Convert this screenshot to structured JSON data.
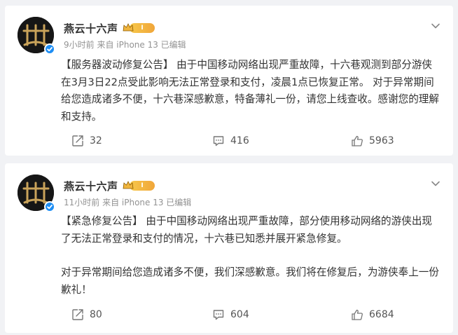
{
  "posts": [
    {
      "author": "燕云十六声",
      "level_badge": "I",
      "meta": "9小时前 来自 iPhone 13 已编辑",
      "paragraphs": [
        "【服务器波动修复公告】 由于中国移动网络出现严重故障，十六巷观测到部分游侠在3月3日22点受此影响无法正常登录和支付，凌晨1点已恢复正常。 对于异常期间给您造成诸多不便，十六巷深感歉意，特备薄礼一份，请您上线查收。感谢您的理解和支持。"
      ],
      "reposts": "32",
      "comments": "416",
      "likes": "5963"
    },
    {
      "author": "燕云十六声",
      "level_badge": "I",
      "meta": "11小时前 来自 iPhone 13 已编辑",
      "paragraphs": [
        "【紧急修复公告】 由于中国移动网络出现严重故障，部分使用移动网络的游侠出现了无法正常登录和支付的情况，十六巷已知悉并展开紧急修复。",
        "对于异常期间给您造成诸多不便，我们深感歉意。我们将在修复后，为游侠奉上一份歉礼！"
      ],
      "reposts": "80",
      "comments": "604",
      "likes": "6684"
    }
  ],
  "icons": {
    "repost": "repost-icon",
    "comment": "comment-icon",
    "like": "like-icon",
    "more": "chevron-down-icon",
    "verified": "verified-icon",
    "crown": "crown-icon"
  },
  "colors": {
    "background": "#f1f2f5",
    "card": "#ffffff",
    "verified_blue": "#1e8ef4",
    "badge_gold": "#f0a63a",
    "meta_gray": "#939393"
  }
}
